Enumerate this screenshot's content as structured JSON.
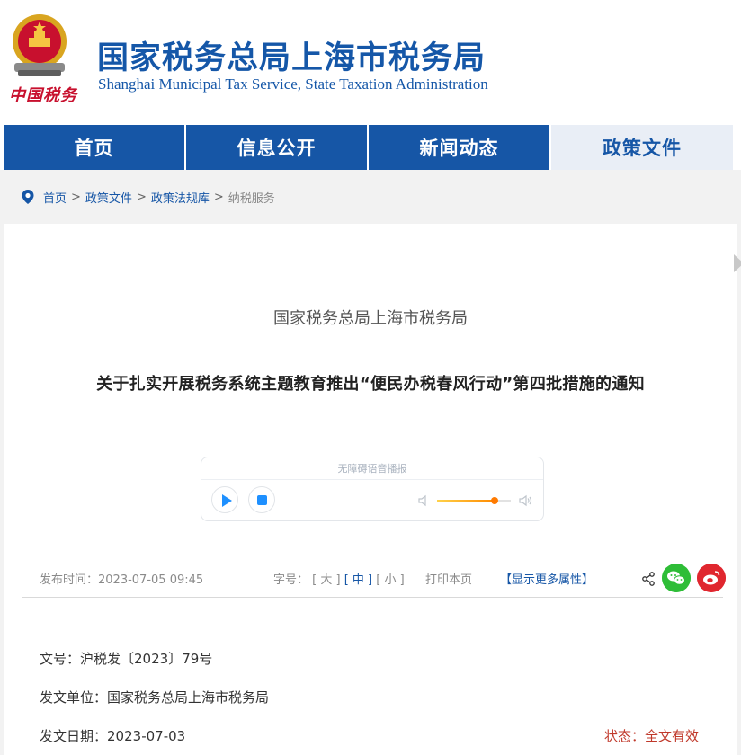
{
  "header": {
    "title": "国家税务总局上海市税务局",
    "subtitle": "Shanghai Municipal Tax Service, State Taxation Administration",
    "logo_text": "中国税务"
  },
  "nav": {
    "items": [
      {
        "label": "首页"
      },
      {
        "label": "信息公开"
      },
      {
        "label": "新闻动态"
      },
      {
        "label": "政策文件"
      }
    ],
    "active": "政策文件"
  },
  "breadcrumb": {
    "items": [
      "首页",
      "政策文件",
      "政策法规库"
    ],
    "current": "纳税服务",
    "separator": ">"
  },
  "article": {
    "agency": "国家税务总局上海市税务局",
    "title": "关于扎实开展税务系统主题教育推出“便民办税春风行动”第四批措施的通知"
  },
  "player": {
    "label": "无障碍语音播报",
    "volume": 0.78
  },
  "meta": {
    "publish_label": "发布时间：",
    "publish_time": "2023-07-05 09:45",
    "fontsize_label": "字号：",
    "size_large": "[ 大 ]",
    "size_medium": "[ 中 ]",
    "size_small": "[ 小 ]",
    "print_label": "打印本页",
    "more_label": "【显示更多属性】"
  },
  "fields": {
    "doc_no_label": "文号：",
    "doc_no": "沪税发〔2023〕79号",
    "issuer_label": "发文单位：",
    "issuer": "国家税务总局上海市税务局",
    "date_label": "发文日期：",
    "date": "2023-07-03",
    "status_label": "状态：",
    "status": "全文有效"
  },
  "colors": {
    "brand_blue": "#1656a6",
    "nav_active_bg": "#e9eef6",
    "status_red": "#c0392b",
    "wechat_green": "#2ebd37",
    "weibo_red": "#e0272f"
  },
  "icons": [
    "emblem-icon",
    "location-pin-icon",
    "chevron-right-icon",
    "play-icon",
    "stop-icon",
    "volume-low-icon",
    "volume-high-icon",
    "share-icon",
    "wechat-icon",
    "weibo-icon"
  ]
}
